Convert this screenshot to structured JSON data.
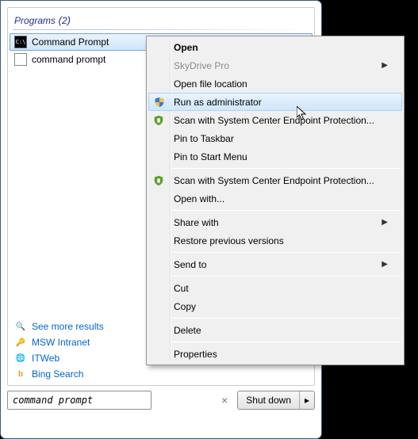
{
  "heading": {
    "label": "Programs",
    "count": 2
  },
  "results": [
    {
      "label": "Command Prompt",
      "selected": true,
      "icon": "cmd"
    },
    {
      "label": "command prompt",
      "selected": false,
      "icon": "doc"
    }
  ],
  "links": [
    {
      "label": "See more results",
      "icon": "magnifier"
    },
    {
      "label": "MSW Intranet",
      "icon": "key"
    },
    {
      "label": "ITWeb",
      "icon": "globe"
    },
    {
      "label": "Bing Search",
      "icon": "bing"
    }
  ],
  "search": {
    "value": "command prompt"
  },
  "shutdown": {
    "label": "Shut down"
  },
  "context_menu": {
    "groups": [
      [
        {
          "label": "Open",
          "bold": true
        },
        {
          "label": "SkyDrive Pro",
          "disabled": true,
          "submenu": true
        },
        {
          "label": "Open file location"
        },
        {
          "label": "Run as administrator",
          "icon": "uac-shield",
          "hover": true
        },
        {
          "label": "Scan with System Center Endpoint Protection...",
          "icon": "scep-shield"
        },
        {
          "label": "Pin to Taskbar"
        },
        {
          "label": "Pin to Start Menu"
        }
      ],
      [
        {
          "label": "Scan with System Center Endpoint Protection...",
          "icon": "scep-shield"
        },
        {
          "label": "Open with..."
        }
      ],
      [
        {
          "label": "Share with",
          "submenu": true
        },
        {
          "label": "Restore previous versions"
        }
      ],
      [
        {
          "label": "Send to",
          "submenu": true
        }
      ],
      [
        {
          "label": "Cut"
        },
        {
          "label": "Copy"
        }
      ],
      [
        {
          "label": "Delete"
        }
      ],
      [
        {
          "label": "Properties"
        }
      ]
    ]
  }
}
